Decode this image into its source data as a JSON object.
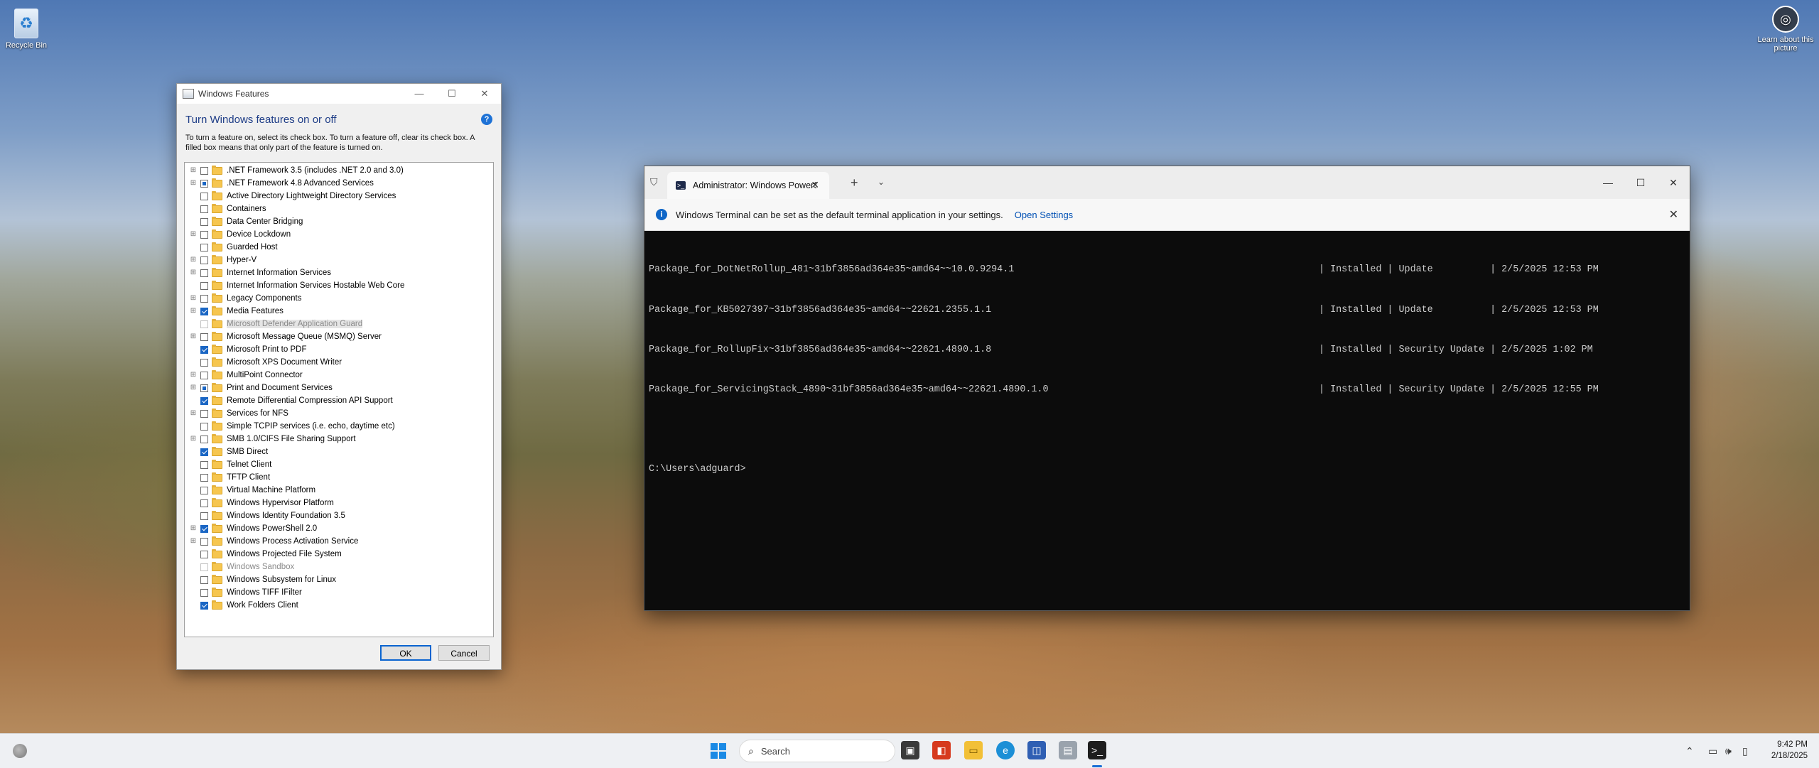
{
  "desktop": {
    "icons": [
      {
        "label": "Recycle Bin"
      },
      {
        "label": "Learn about this picture"
      }
    ]
  },
  "features_dialog": {
    "title": "Windows Features",
    "heading": "Turn Windows features on or off",
    "description": "To turn a feature on, select its check box. To turn a feature off, clear its check box. A filled box means that only part of the feature is turned on.",
    "ok_label": "OK",
    "cancel_label": "Cancel",
    "features": [
      {
        "label": ".NET Framework 3.5 (includes .NET 2.0 and 3.0)",
        "expandable": true,
        "state": "unchecked"
      },
      {
        "label": ".NET Framework 4.8 Advanced Services",
        "expandable": true,
        "state": "partial"
      },
      {
        "label": "Active Directory Lightweight Directory Services",
        "expandable": false,
        "state": "unchecked"
      },
      {
        "label": "Containers",
        "expandable": false,
        "state": "unchecked"
      },
      {
        "label": "Data Center Bridging",
        "expandable": false,
        "state": "unchecked"
      },
      {
        "label": "Device Lockdown",
        "expandable": true,
        "state": "unchecked"
      },
      {
        "label": "Guarded Host",
        "expandable": false,
        "state": "unchecked"
      },
      {
        "label": "Hyper-V",
        "expandable": true,
        "state": "unchecked"
      },
      {
        "label": "Internet Information Services",
        "expandable": true,
        "state": "unchecked"
      },
      {
        "label": "Internet Information Services Hostable Web Core",
        "expandable": false,
        "state": "unchecked"
      },
      {
        "label": "Legacy Components",
        "expandable": true,
        "state": "unchecked"
      },
      {
        "label": "Media Features",
        "expandable": true,
        "state": "checked"
      },
      {
        "label": "Microsoft Defender Application Guard",
        "expandable": false,
        "state": "disabled"
      },
      {
        "label": "Microsoft Message Queue (MSMQ) Server",
        "expandable": true,
        "state": "unchecked"
      },
      {
        "label": "Microsoft Print to PDF",
        "expandable": false,
        "state": "checked"
      },
      {
        "label": "Microsoft XPS Document Writer",
        "expandable": false,
        "state": "unchecked"
      },
      {
        "label": "MultiPoint Connector",
        "expandable": true,
        "state": "unchecked"
      },
      {
        "label": "Print and Document Services",
        "expandable": true,
        "state": "partial"
      },
      {
        "label": "Remote Differential Compression API Support",
        "expandable": false,
        "state": "checked"
      },
      {
        "label": "Services for NFS",
        "expandable": true,
        "state": "unchecked"
      },
      {
        "label": "Simple TCPIP services (i.e. echo, daytime etc)",
        "expandable": false,
        "state": "unchecked"
      },
      {
        "label": "SMB 1.0/CIFS File Sharing Support",
        "expandable": true,
        "state": "unchecked"
      },
      {
        "label": "SMB Direct",
        "expandable": false,
        "state": "checked"
      },
      {
        "label": "Telnet Client",
        "expandable": false,
        "state": "unchecked"
      },
      {
        "label": "TFTP Client",
        "expandable": false,
        "state": "unchecked"
      },
      {
        "label": "Virtual Machine Platform",
        "expandable": false,
        "state": "unchecked"
      },
      {
        "label": "Windows Hypervisor Platform",
        "expandable": false,
        "state": "unchecked"
      },
      {
        "label": "Windows Identity Foundation 3.5",
        "expandable": false,
        "state": "unchecked"
      },
      {
        "label": "Windows PowerShell 2.0",
        "expandable": true,
        "state": "checked"
      },
      {
        "label": "Windows Process Activation Service",
        "expandable": true,
        "state": "unchecked"
      },
      {
        "label": "Windows Projected File System",
        "expandable": false,
        "state": "unchecked"
      },
      {
        "label": "Windows Sandbox",
        "expandable": false,
        "state": "disabled"
      },
      {
        "label": "Windows Subsystem for Linux",
        "expandable": false,
        "state": "unchecked"
      },
      {
        "label": "Windows TIFF IFilter",
        "expandable": false,
        "state": "unchecked"
      },
      {
        "label": "Work Folders Client",
        "expandable": false,
        "state": "checked"
      }
    ]
  },
  "terminal": {
    "tab_title": "Administrator: Windows PowerShell",
    "infobar_message": "Windows Terminal can be set as the default terminal application in your settings.",
    "infobar_link": "Open Settings",
    "packages": [
      {
        "name": "Package_for_DotNetRollup_481~31bf3856ad364e35~amd64~~10.0.9294.1",
        "status": "| Installed | Update          | 2/5/2025 12:53 PM"
      },
      {
        "name": "Package_for_KB5027397~31bf3856ad364e35~amd64~~22621.2355.1.1",
        "status": "| Installed | Update          | 2/5/2025 12:53 PM"
      },
      {
        "name": "Package_for_RollupFix~31bf3856ad364e35~amd64~~22621.4890.1.8",
        "status": "| Installed | Security Update | 2/5/2025 1:02 PM"
      },
      {
        "name": "Package_for_ServicingStack_4890~31bf3856ad364e35~amd64~~22621.4890.1.0",
        "status": "| Installed | Security Update | 2/5/2025 12:55 PM"
      }
    ],
    "prompt": "C:\\Users\\adguard>"
  },
  "taskbar": {
    "search_placeholder": "Search",
    "time": "9:42 PM",
    "date": "2/18/2025"
  }
}
